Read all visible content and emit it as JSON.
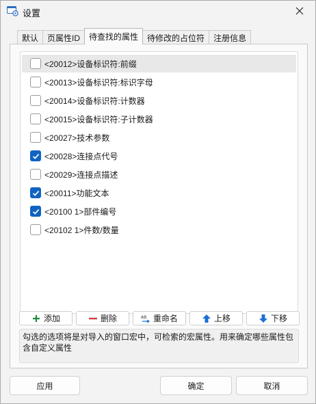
{
  "window": {
    "title": "设置"
  },
  "tabs": [
    {
      "label": "默认",
      "active": false
    },
    {
      "label": "页属性ID",
      "active": false
    },
    {
      "label": "待查找的属性",
      "active": true
    },
    {
      "label": "待修改的占位符",
      "active": false
    },
    {
      "label": "注册信息",
      "active": false
    }
  ],
  "items": [
    {
      "label": "<20012>设备标识符:前缀",
      "checked": false
    },
    {
      "label": "<20013>设备标识符:标识字母",
      "checked": false
    },
    {
      "label": "<20014>设备标识符:计数器",
      "checked": false
    },
    {
      "label": "<20015>设备标识符:子计数器",
      "checked": false
    },
    {
      "label": "<20027>技术参数",
      "checked": false
    },
    {
      "label": "<20028>连接点代号",
      "checked": true
    },
    {
      "label": "<20029>连接点描述",
      "checked": false
    },
    {
      "label": "<20011>功能文本",
      "checked": true
    },
    {
      "label": "<20100 1>部件编号",
      "checked": true
    },
    {
      "label": "<20102 1>件数/数量",
      "checked": false
    }
  ],
  "toolbar": {
    "add": "添加",
    "delete": "删除",
    "rename": "重命名",
    "move_up": "上移",
    "move_down": "下移"
  },
  "description": "勾选的选项将是对导入的窗口宏中，可检索的宏属性。用来确定哪些属性包含自定义属性",
  "footer": {
    "apply": "应用",
    "ok": "确定",
    "cancel": "取消"
  },
  "colors": {
    "accent": "#0f63c2",
    "add": "#1e8a3c",
    "delete": "#d23a3a",
    "arrow": "#1c6fd6"
  },
  "icons": {
    "app": "settings-window-icon",
    "close": "close-icon"
  }
}
